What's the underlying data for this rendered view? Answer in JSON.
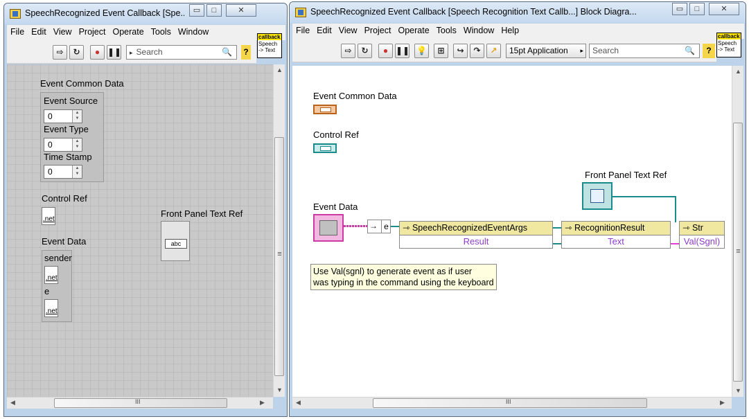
{
  "front_panel": {
    "title": "SpeechRecognized Event Callback [Spe...",
    "menu": [
      "File",
      "Edit",
      "View",
      "Project",
      "Operate",
      "Tools",
      "Window"
    ],
    "search_placeholder": "Search",
    "icon_top": "callback",
    "icon_bottom": "Speech -> Text",
    "event_common_data_label": "Event Common Data",
    "event_source_label": "Event Source",
    "event_source_value": "0",
    "event_type_label": "Event Type",
    "event_type_value": "0",
    "time_stamp_label": "Time Stamp",
    "time_stamp_value": "0",
    "control_ref_label": "Control Ref",
    "control_ref_glyph": ".net",
    "event_data_label": "Event Data",
    "sender_label": "sender",
    "sender_glyph": ".net",
    "e_label": "e",
    "e_glyph": ".net",
    "front_panel_text_ref_label": "Front Panel Text Ref",
    "front_panel_text_ref_glyph": "abc",
    "hscroll_glyph": "III",
    "vscroll_mark": "≡"
  },
  "block_diagram": {
    "title": "SpeechRecognized Event Callback [Speech Recognition Text Callb...] Block Diagra...",
    "menu": [
      "File",
      "Edit",
      "View",
      "Project",
      "Operate",
      "Tools",
      "Window",
      "Help"
    ],
    "font_select": "15pt Application",
    "search_placeholder": "Search",
    "icon_top": "callback",
    "icon_bottom": "Speech -> Text",
    "event_common_data_label": "Event Common Data",
    "control_ref_label": "Control Ref",
    "front_panel_text_ref_label": "Front Panel Text Ref",
    "event_data_label": "Event Data",
    "unbundle_label": "e",
    "node1_header": "SpeechRecognizedEventArgs",
    "node1_prop": "Result",
    "node2_header": "RecognitionResult",
    "node2_prop": "Text",
    "node3_header": "Str",
    "node3_prop": "Val(Sgnl)",
    "comment": [
      "Use Val(sgnl) to generate event as if user",
      "was typing in the command using the keyboard"
    ],
    "hscroll_glyph": "III",
    "vscroll_mark": "≡"
  },
  "colors": {
    "cluster_wire": "#cc3aa3",
    "refnum_wire": "#1a8a8a",
    "string_wire": "#e040d0"
  }
}
